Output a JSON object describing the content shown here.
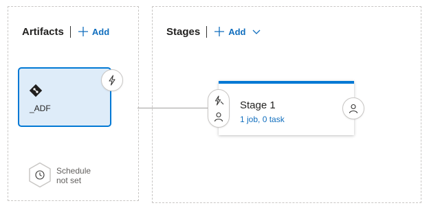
{
  "artifacts": {
    "title": "Artifacts",
    "add_label": "Add",
    "items": [
      {
        "name": "_ADF",
        "icon": "git-icon"
      }
    ],
    "trigger_icon": "lightning-icon",
    "schedule": {
      "line1": "Schedule",
      "line2": "not set",
      "icon": "clock-icon"
    }
  },
  "stages": {
    "title": "Stages",
    "add_label": "Add",
    "items": [
      {
        "name": "Stage 1",
        "summary": "1 job, 0 task"
      }
    ]
  },
  "colors": {
    "accent": "#0078d4",
    "link": "#106ebe",
    "artifact_card_bg": "#deecf9",
    "panel_border": "#c8c6c4"
  }
}
